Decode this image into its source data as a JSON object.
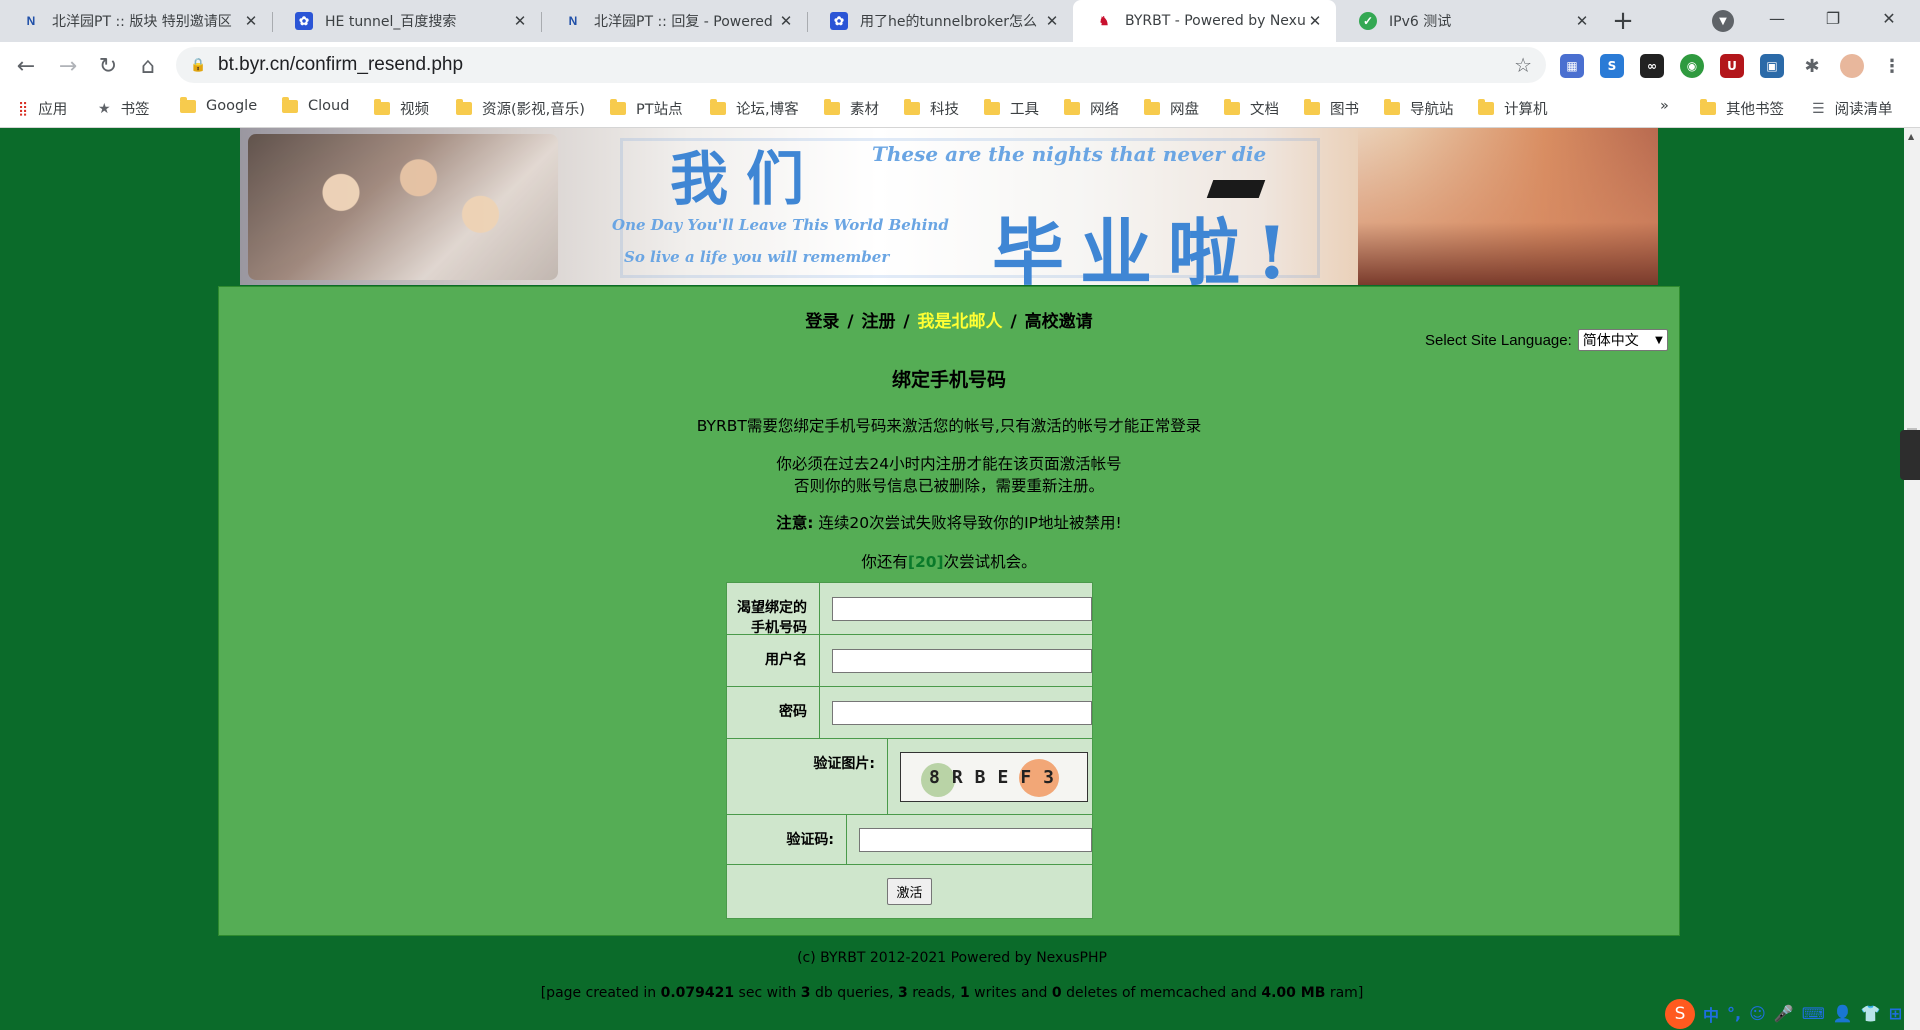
{
  "browser": {
    "tabs": [
      {
        "title": "北洋园PT :: 版块 特别邀请区",
        "favicon": "N"
      },
      {
        "title": "HE tunnel_百度搜索",
        "favicon": "paw"
      },
      {
        "title": "北洋园PT :: 回复 - Powered",
        "favicon": "N"
      },
      {
        "title": "用了he的tunnelbroker怎么",
        "favicon": "paw"
      },
      {
        "title": "BYRBT - Powered by Nexus",
        "favicon": "byr"
      },
      {
        "title": "IPv6 测试",
        "favicon": "check"
      }
    ],
    "active_tab_index": 4,
    "url": "bt.byr.cn/confirm_resend.php",
    "bookmarks": [
      {
        "label": "应用",
        "icon": "apps-icon"
      },
      {
        "label": "书签",
        "icon": "star-icon"
      },
      {
        "label": "Google",
        "icon": "folder-icon"
      },
      {
        "label": "Cloud",
        "icon": "folder-icon"
      },
      {
        "label": "视频",
        "icon": "folder-icon"
      },
      {
        "label": "资源(影视,音乐)",
        "icon": "folder-icon"
      },
      {
        "label": "PT站点",
        "icon": "folder-icon"
      },
      {
        "label": "论坛,博客",
        "icon": "folder-icon"
      },
      {
        "label": "素材",
        "icon": "folder-icon"
      },
      {
        "label": "科技",
        "icon": "folder-icon"
      },
      {
        "label": "工具",
        "icon": "folder-icon"
      },
      {
        "label": "网络",
        "icon": "folder-icon"
      },
      {
        "label": "网盘",
        "icon": "folder-icon"
      },
      {
        "label": "文档",
        "icon": "folder-icon"
      },
      {
        "label": "图书",
        "icon": "folder-icon"
      },
      {
        "label": "导航站",
        "icon": "folder-icon"
      },
      {
        "label": "计算机",
        "icon": "folder-icon"
      }
    ],
    "bookmarks_overflow": "»",
    "other_bookmarks": "其他书签",
    "reading_list": "阅读清单"
  },
  "banner": {
    "title_line1": "我们",
    "title_line2": "毕业啦!",
    "english_1": "These are the nights that never die",
    "english_2": "One Day You'll Leave This World Behind",
    "english_3": "So live a life you will remember"
  },
  "nav": {
    "login": "登录",
    "register": "注册",
    "byr_user": "我是北邮人",
    "school_invite": "高校邀请",
    "separator": "/"
  },
  "language": {
    "label": "Select Site Language:",
    "selected": "简体中文"
  },
  "content": {
    "heading": "绑定手机号码",
    "intro": "BYRBT需要您绑定手机号码来激活您的帐号,只有激活的帐号才能正常登录",
    "rule_line1": "你必须在过去24小时内注册才能在该页面激活帐号",
    "rule_line2": "否则你的账号信息已被删除，需要重新注册。",
    "warning_label": "注意:",
    "warning_text": "连续20次尝试失败将导致你的IP地址被禁用!",
    "attempts_prefix": "你还有",
    "attempts_count": "[20]",
    "attempts_suffix": "次尝试机会。"
  },
  "form": {
    "phone_label": "渴望绑定的手机号码",
    "phone_value": "",
    "username_label": "用户名",
    "username_value": "",
    "password_label": "密码",
    "password_value": "",
    "captcha_image_label": "验证图片:",
    "captcha_text": "8RBEF3",
    "captcha_code_label": "验证码:",
    "captcha_code_value": "",
    "submit_label": "激活"
  },
  "footer": {
    "copyright": "(c) BYRBT 2012-2021 Powered by NexusPHP",
    "stats_open": "[page created in ",
    "time": "0.079421",
    "sec_with": " sec with ",
    "queries": "3",
    "db_queries": " db queries, ",
    "reads": "3",
    "reads_label": " reads, ",
    "writes": "1",
    "writes_label": " writes and ",
    "deletes": "0",
    "deletes_label": " deletes of memcached and ",
    "ram": "4.00 MB",
    "ram_close": " ram]"
  },
  "ime": {
    "mode": "中"
  }
}
